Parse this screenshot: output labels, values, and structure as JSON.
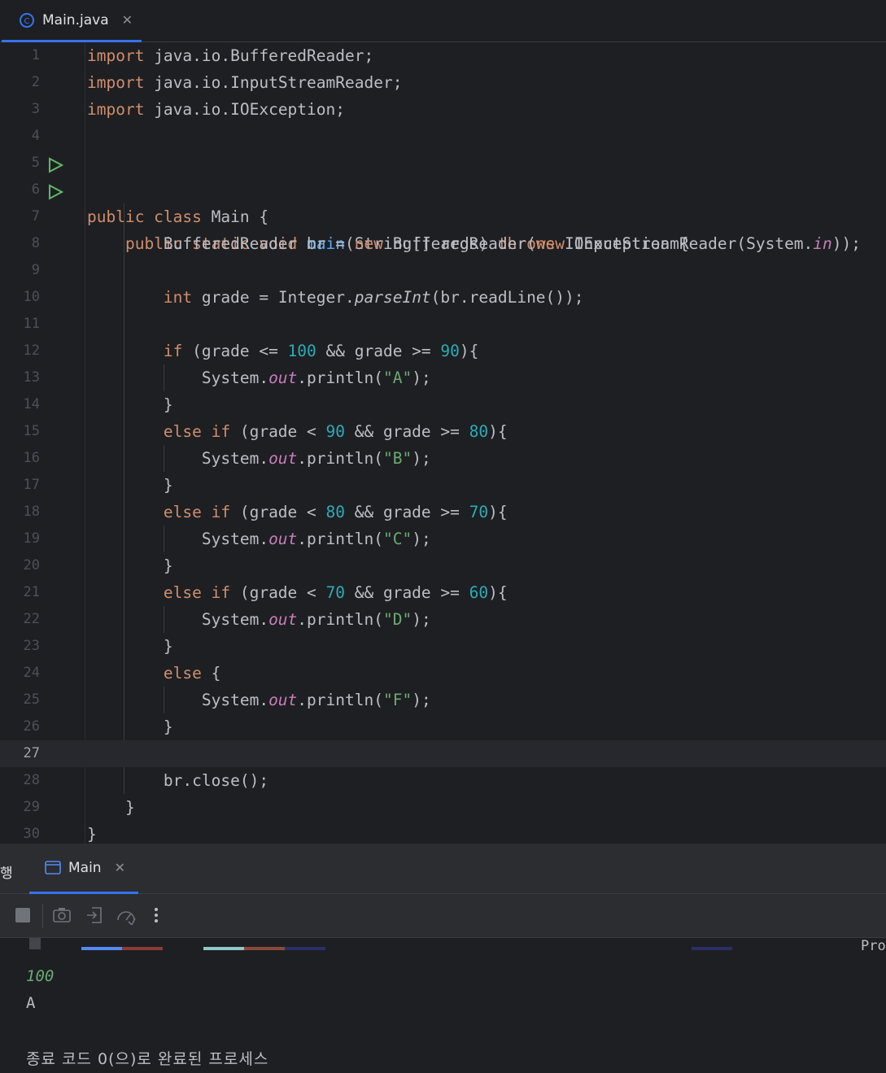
{
  "editor_tab": {
    "filename": "Main.java",
    "close": "✕"
  },
  "code_lines": [
    {
      "n": "1"
    },
    {
      "n": "2"
    },
    {
      "n": "3"
    },
    {
      "n": "4"
    },
    {
      "n": "5"
    },
    {
      "n": "6"
    },
    {
      "n": "7"
    },
    {
      "n": "8"
    },
    {
      "n": "9"
    },
    {
      "n": "10"
    },
    {
      "n": "11"
    },
    {
      "n": "12"
    },
    {
      "n": "13"
    },
    {
      "n": "14"
    },
    {
      "n": "15"
    },
    {
      "n": "16"
    },
    {
      "n": "17"
    },
    {
      "n": "18"
    },
    {
      "n": "19"
    },
    {
      "n": "20"
    },
    {
      "n": "21"
    },
    {
      "n": "22"
    },
    {
      "n": "23"
    },
    {
      "n": "24"
    },
    {
      "n": "25"
    },
    {
      "n": "26"
    },
    {
      "n": "27"
    },
    {
      "n": "28"
    },
    {
      "n": "29"
    },
    {
      "n": "30"
    }
  ],
  "code": {
    "l1": [
      "import",
      " java.io.BufferedReader;"
    ],
    "l2": [
      "import",
      " java.io.InputStreamReader;"
    ],
    "l3": [
      "import",
      " java.io.IOException;"
    ],
    "l5": [
      "public class",
      " Main {"
    ],
    "l6": [
      "    ",
      "public static void",
      " ",
      "main",
      "(String[] args) ",
      "throws",
      " IOException {"
    ],
    "l8": [
      "        BufferedReader br = ",
      "new",
      " BufferedReader(",
      "new",
      " InputStreamReader(System.",
      "in",
      "));"
    ],
    "l10": [
      "        ",
      "int",
      " grade = Integer.",
      "parseInt",
      "(br.readLine());"
    ],
    "l12": [
      "        ",
      "if",
      " (grade <= ",
      "100",
      " && grade >= ",
      "90",
      "){"
    ],
    "l13": [
      "            System.",
      "out",
      ".println(",
      "\"A\"",
      ");"
    ],
    "l14": [
      "        }"
    ],
    "l15": [
      "        ",
      "else if",
      " (grade < ",
      "90",
      " && grade >= ",
      "80",
      "){"
    ],
    "l16": [
      "            System.",
      "out",
      ".println(",
      "\"B\"",
      ");"
    ],
    "l17": [
      "        }"
    ],
    "l18": [
      "        ",
      "else if",
      " (grade < ",
      "80",
      " && grade >= ",
      "70",
      "){"
    ],
    "l19": [
      "            System.",
      "out",
      ".println(",
      "\"C\"",
      ");"
    ],
    "l20": [
      "        }"
    ],
    "l21": [
      "        ",
      "else if",
      " (grade < ",
      "70",
      " && grade >= ",
      "60",
      "){"
    ],
    "l22": [
      "            System.",
      "out",
      ".println(",
      "\"D\"",
      ");"
    ],
    "l23": [
      "        }"
    ],
    "l24": [
      "        ",
      "else",
      " {"
    ],
    "l25": [
      "            System.",
      "out",
      ".println(",
      "\"F\"",
      ");"
    ],
    "l26": [
      "        }"
    ],
    "l28": [
      "        br.close();"
    ],
    "l29": [
      "    }"
    ],
    "l30": [
      "}"
    ]
  },
  "run_panel": {
    "title": "행",
    "tab_label": "Main",
    "tab_close": "✕",
    "cmdline_tail": "Pro",
    "console_input": "100",
    "console_output": "A",
    "exit_message": "종료 코드 0(으)로 완료된 프로세스"
  },
  "colors": {
    "keyword": "#cf8e6d",
    "function": "#56a8f5",
    "number": "#2aacb8",
    "string": "#6aab73",
    "static_field": "#c77dbb",
    "accent": "#3574f0",
    "run_gutter": "#5fb865"
  },
  "icons": [
    "java-class-icon",
    "run-gutter-icon",
    "console-icon",
    "stop-icon",
    "camera-icon",
    "login-icon",
    "profiler-icon",
    "more-icon"
  ]
}
